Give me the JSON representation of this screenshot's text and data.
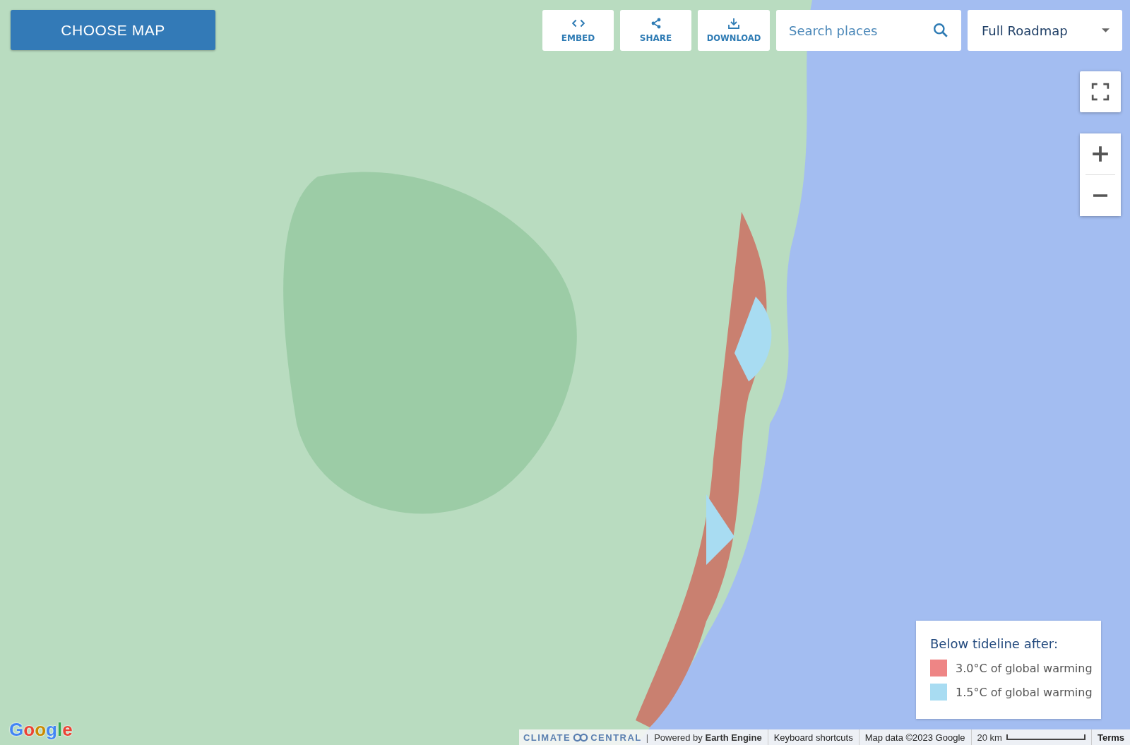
{
  "choose_map_button": "CHOOSE MAP",
  "toolbar": [
    {
      "kind": "embed",
      "label": "EMBED"
    },
    {
      "kind": "share",
      "label": "SHARE"
    },
    {
      "kind": "download",
      "label": "DOWNLOAD"
    }
  ],
  "search": {
    "placeholder": "Search places"
  },
  "map_type": {
    "value": "Full Roadmap"
  },
  "legend": {
    "title": "Below tideline after:",
    "items": [
      {
        "label": "3.0°C of global warming",
        "color": "#ee8585"
      },
      {
        "label": "1.5°C of global warming",
        "color": "#a8dcf2"
      }
    ]
  },
  "google_logo": "Google",
  "attribution": {
    "logo_left": "CLIMATE",
    "logo_right": "CENTRAL",
    "separator": "|",
    "powered_by": "Powered by **Earth Engine**",
    "links": [
      "Keyboard shortcuts",
      "Map data ©2023 Google"
    ],
    "scale": "20 km",
    "terms": "Terms"
  }
}
